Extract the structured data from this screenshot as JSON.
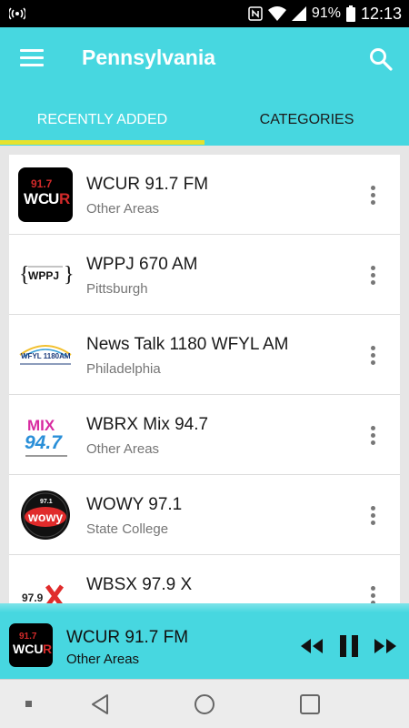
{
  "status_bar": {
    "battery": "91%",
    "time": "12:13",
    "icons": [
      "broadcast-icon",
      "nfc-icon",
      "wifi-icon",
      "signal-icon",
      "battery-icon"
    ]
  },
  "app_bar": {
    "title": "Pennsylvania",
    "menu_icon": "hamburger-menu-icon",
    "search_icon": "search-icon",
    "background_color": "#47d7e0"
  },
  "tabs": [
    {
      "label": "RECENTLY ADDED",
      "selected": true
    },
    {
      "label": "CATEGORIES",
      "selected": false
    }
  ],
  "tab_indicator_color": "#e6e22e",
  "stations": [
    {
      "name": "WCUR 91.7 FM",
      "location": "Other Areas",
      "logo_text": "91.7 WCUR"
    },
    {
      "name": "WPPJ 670 AM",
      "location": "Pittsburgh",
      "logo_text": "WPPJ"
    },
    {
      "name": "News Talk 1180 WFYL AM",
      "location": "Philadelphia",
      "logo_text": "WFYL 1180AM"
    },
    {
      "name": "WBRX Mix 94.7",
      "location": "Other Areas",
      "logo_text": "MIX 94.7"
    },
    {
      "name": "WOWY 97.1",
      "location": "State College",
      "logo_text": "97.1 WOWY"
    },
    {
      "name": "WBSX 97.9 X",
      "location": "",
      "logo_text": "97.9 X"
    }
  ],
  "player": {
    "title": "WCUR 91.7 FM",
    "subtitle": "Other Areas",
    "logo_text": "91.7 WCUR",
    "controls": [
      "rewind-icon",
      "pause-icon",
      "fast-forward-icon"
    ]
  },
  "nav_bar": {
    "buttons": [
      "recent-apps-dot",
      "back-icon",
      "home-icon",
      "overview-icon"
    ]
  }
}
